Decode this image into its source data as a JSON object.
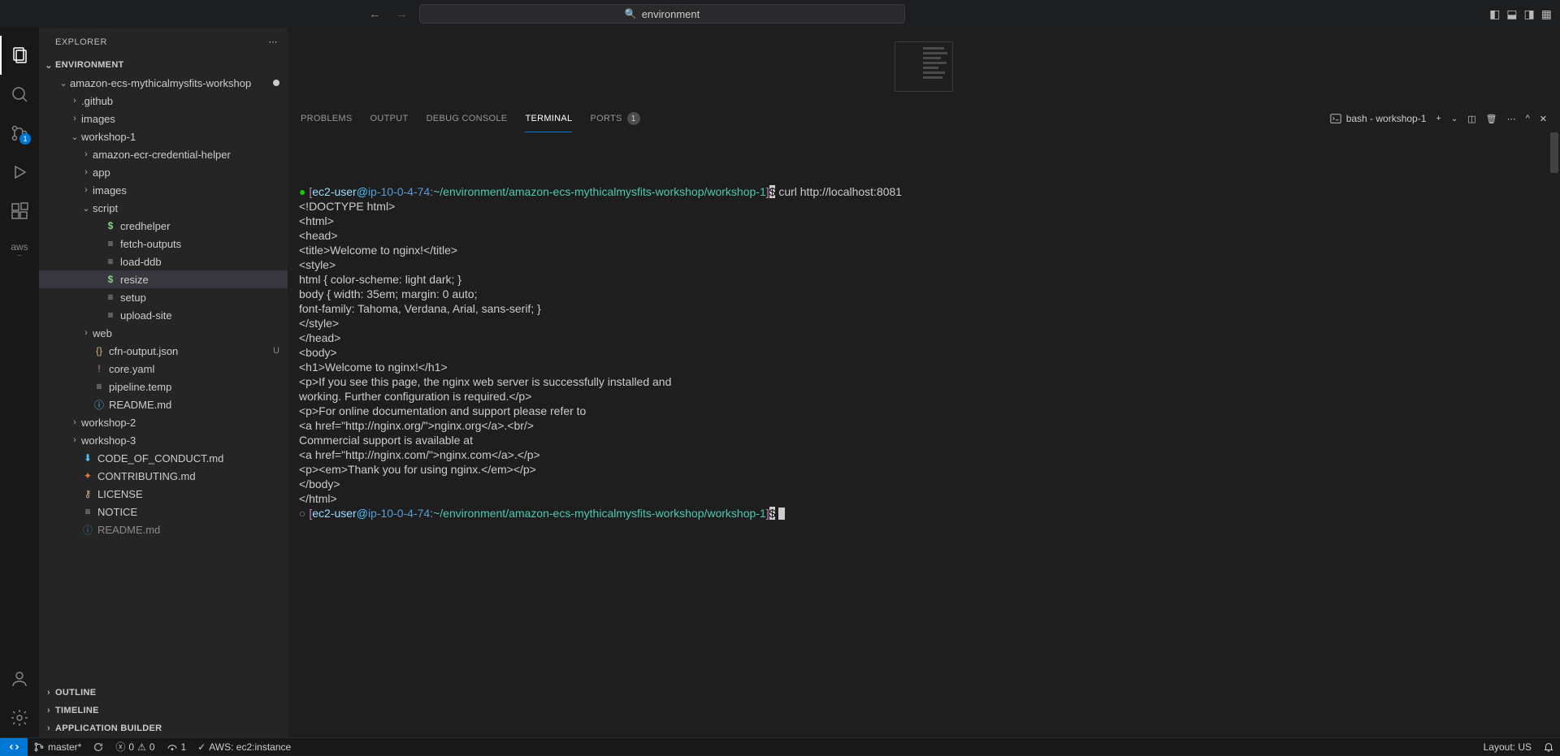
{
  "titlebar": {
    "search_text": "environment"
  },
  "activity": {
    "scm_badge": "1",
    "aws_label": "aws"
  },
  "sidebar": {
    "title": "EXPLORER",
    "root": "ENVIRONMENT",
    "tree": [
      {
        "label": "amazon-ecs-mythicalmysfits-workshop",
        "indent": 1,
        "chev": "v",
        "modified": true
      },
      {
        "label": ".github",
        "indent": 2,
        "chev": ">"
      },
      {
        "label": "images",
        "indent": 2,
        "chev": ">"
      },
      {
        "label": "workshop-1",
        "indent": 2,
        "chev": "v"
      },
      {
        "label": "amazon-ecr-credential-helper",
        "indent": 3,
        "chev": ">"
      },
      {
        "label": "app",
        "indent": 3,
        "chev": ">"
      },
      {
        "label": "images",
        "indent": 3,
        "chev": ">"
      },
      {
        "label": "script",
        "indent": 3,
        "chev": "v"
      },
      {
        "label": "credhelper",
        "indent": 4,
        "icon": "dollar"
      },
      {
        "label": "fetch-outputs",
        "indent": 4,
        "icon": "lines"
      },
      {
        "label": "load-ddb",
        "indent": 4,
        "icon": "lines"
      },
      {
        "label": "resize",
        "indent": 4,
        "icon": "dollar",
        "selected": true
      },
      {
        "label": "setup",
        "indent": 4,
        "icon": "lines"
      },
      {
        "label": "upload-site",
        "indent": 4,
        "icon": "lines"
      },
      {
        "label": "web",
        "indent": 3,
        "chev": ">"
      },
      {
        "label": "cfn-output.json",
        "indent": 3,
        "icon": "json",
        "status": "U"
      },
      {
        "label": "core.yaml",
        "indent": 3,
        "icon": "yaml"
      },
      {
        "label": "pipeline.temp",
        "indent": 3,
        "icon": "lines"
      },
      {
        "label": "README.md",
        "indent": 3,
        "icon": "info"
      },
      {
        "label": "workshop-2",
        "indent": 2,
        "chev": ">"
      },
      {
        "label": "workshop-3",
        "indent": 2,
        "chev": ">"
      },
      {
        "label": "CODE_OF_CONDUCT.md",
        "indent": 2,
        "icon": "conduct"
      },
      {
        "label": "CONTRIBUTING.md",
        "indent": 2,
        "icon": "contrib"
      },
      {
        "label": "LICENSE",
        "indent": 2,
        "icon": "license"
      },
      {
        "label": "NOTICE",
        "indent": 2,
        "icon": "lines"
      },
      {
        "label": "README.md",
        "indent": 2,
        "icon": "info",
        "faded": true
      }
    ],
    "sections": [
      "OUTLINE",
      "TIMELINE",
      "APPLICATION BUILDER"
    ]
  },
  "panel": {
    "tabs": {
      "problems": "PROBLEMS",
      "output": "OUTPUT",
      "debug": "DEBUG CONSOLE",
      "terminal": "TERMINAL",
      "ports": "PORTS",
      "ports_badge": "1"
    },
    "terminal_name": "bash - workshop-1"
  },
  "terminal": {
    "prompt1_user": "ec2-user",
    "prompt1_host": "ip-10-0-4-74",
    "prompt1_path": "~/environment/amazon-ecs-mythicalmysfits-workshop/workshop-1",
    "cmd1": " curl http://localhost:8081",
    "lines": [
      "<!DOCTYPE html>",
      "<html>",
      "<head>",
      "<title>Welcome to nginx!</title>",
      "<style>",
      "html { color-scheme: light dark; }",
      "body { width: 35em; margin: 0 auto;",
      "font-family: Tahoma, Verdana, Arial, sans-serif; }",
      "</style>",
      "</head>",
      "<body>",
      "<h1>Welcome to nginx!</h1>",
      "<p>If you see this page, the nginx web server is successfully installed and",
      "working. Further configuration is required.</p>",
      "",
      "<p>For online documentation and support please refer to",
      "<a href=\"http://nginx.org/\">nginx.org</a>.<br/>",
      "Commercial support is available at",
      "<a href=\"http://nginx.com/\">nginx.com</a>.</p>",
      "",
      "<p><em>Thank you for using nginx.</em></p>",
      "</body>",
      "</html>"
    ]
  },
  "statusbar": {
    "branch": "master*",
    "errors": "0",
    "warnings": "0",
    "ports": "1",
    "aws": "AWS: ec2:instance",
    "layout": "Layout: US"
  }
}
